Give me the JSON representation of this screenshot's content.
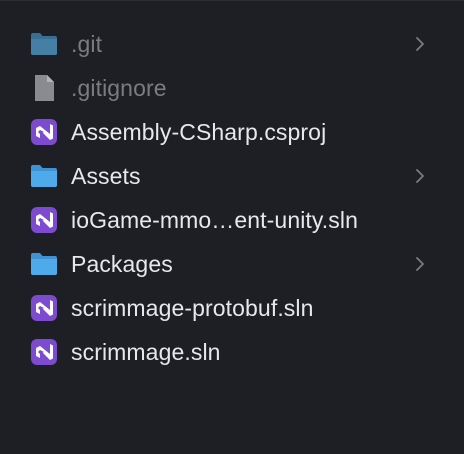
{
  "files": [
    {
      "name": ".git",
      "kind": "folder",
      "dimmed": true,
      "has_chevron": true,
      "icon": "folder-icon"
    },
    {
      "name": ".gitignore",
      "kind": "document",
      "dimmed": true,
      "has_chevron": false,
      "icon": "document-icon"
    },
    {
      "name": "Assembly-CSharp.csproj",
      "kind": "visual-studio",
      "dimmed": false,
      "has_chevron": false,
      "icon": "visual-studio-icon"
    },
    {
      "name": "Assets",
      "kind": "folder",
      "dimmed": false,
      "has_chevron": true,
      "icon": "folder-icon"
    },
    {
      "name": "ioGame-mmo…ent-unity.sln",
      "kind": "visual-studio",
      "dimmed": false,
      "has_chevron": false,
      "icon": "visual-studio-icon"
    },
    {
      "name": "Packages",
      "kind": "folder",
      "dimmed": false,
      "has_chevron": true,
      "icon": "folder-icon"
    },
    {
      "name": "scrimmage-protobuf.sln",
      "kind": "visual-studio",
      "dimmed": false,
      "has_chevron": false,
      "icon": "visual-studio-icon"
    },
    {
      "name": "scrimmage.sln",
      "kind": "visual-studio",
      "dimmed": false,
      "has_chevron": false,
      "icon": "visual-studio-icon"
    }
  ],
  "colors": {
    "background": "#1e1f24",
    "text": "#e8e8ea",
    "dim_text": "#7a7c82",
    "folder": "#4aa6e6",
    "folder_dim": "#3f7fa8",
    "vs_purple": "#8a55d8"
  }
}
